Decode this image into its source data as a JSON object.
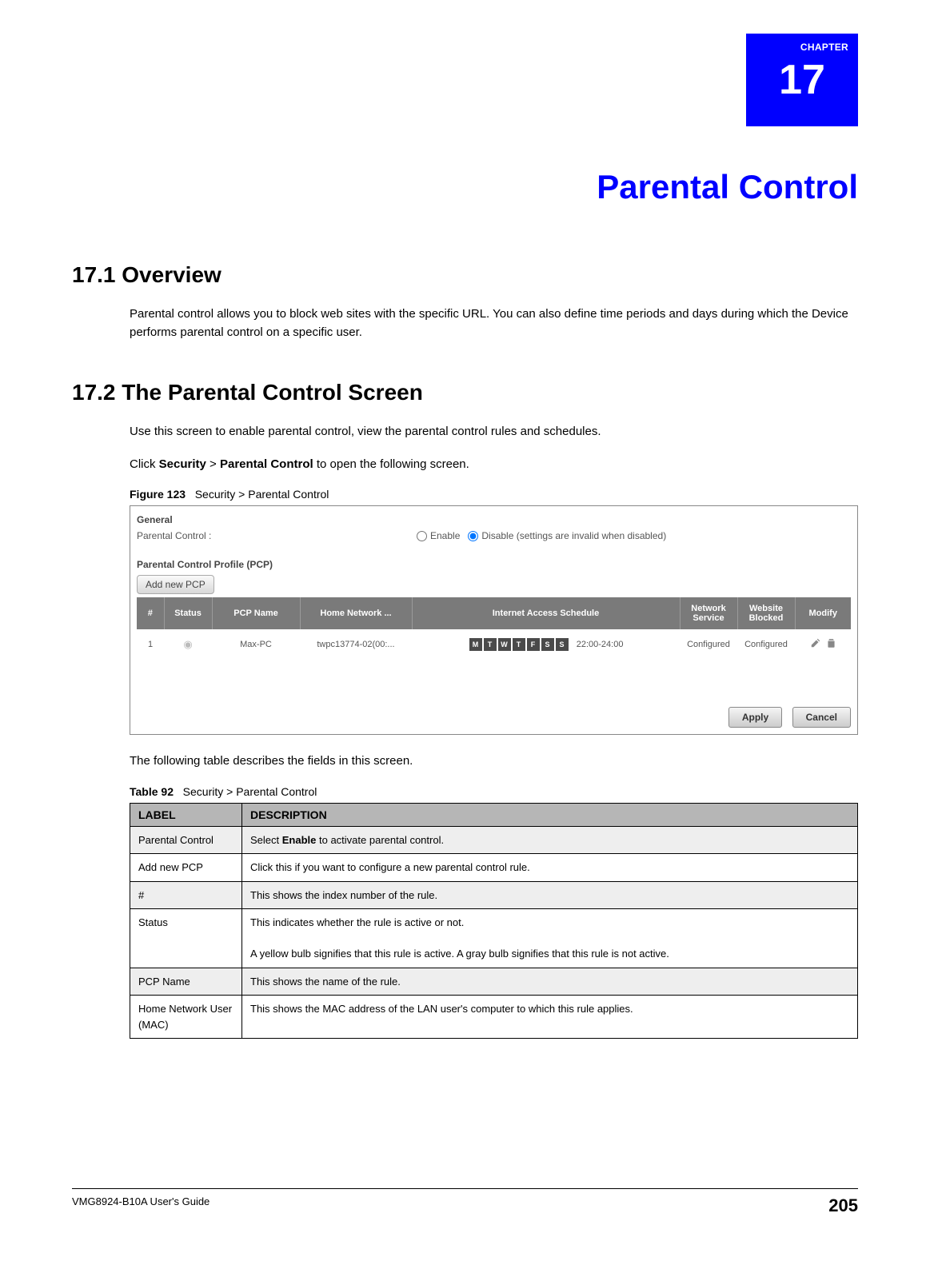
{
  "chapter": {
    "word": "CHAPTER",
    "number": "17",
    "title": "Parental Control"
  },
  "sec1": {
    "heading": "17.1  Overview",
    "p1": "Parental control allows you to block web sites with the specific URL. You can also define time periods and days during which the Device performs parental control on a specific user."
  },
  "sec2": {
    "heading": "17.2  The Parental Control Screen",
    "p1": "Use this screen to enable parental control, view the parental control rules and schedules.",
    "p2_pre": "Click ",
    "p2_b1": "Security",
    "p2_mid": " > ",
    "p2_b2": "Parental Control",
    "p2_post": " to open the following screen."
  },
  "figure": {
    "label": "Figure 123",
    "title": "Security > Parental Control",
    "general_label": "General",
    "pc_label": "Parental Control :",
    "enable": "Enable",
    "disable": "Disable",
    "disable_note": "(settings are invalid when disabled)",
    "pcp_heading": "Parental Control Profile (PCP)",
    "add_btn": "Add new PCP",
    "cols": {
      "idx": "#",
      "status": "Status",
      "pcp_name": "PCP Name",
      "home_net": "Home Network ...",
      "ias": "Internet Access Schedule",
      "net_svc": "Network Service",
      "web_blk": "Website Blocked",
      "modify": "Modify"
    },
    "row": {
      "idx": "1",
      "pcp_name": "Max-PC",
      "home_net": "twpc13774-02(00:...",
      "days": [
        "M",
        "T",
        "W",
        "T",
        "F",
        "S",
        "S"
      ],
      "time": "22:00-24:00",
      "net_svc": "Configured",
      "web_blk": "Configured"
    },
    "apply_btn": "Apply",
    "cancel_btn": "Cancel"
  },
  "after_fig_p": "The following table describes the fields in this screen.",
  "table_caption": {
    "label": "Table 92",
    "title": "Security > Parental Control"
  },
  "desc_table": {
    "header": {
      "label": "LABEL",
      "desc": "DESCRIPTION"
    },
    "rows": [
      {
        "label": "Parental Control",
        "desc_pre": "Select ",
        "desc_b": "Enable",
        "desc_post": " to activate parental control."
      },
      {
        "label": "Add new PCP",
        "desc": "Click this if you want to configure a new parental control rule."
      },
      {
        "label": "#",
        "desc": "This shows the index number of the rule."
      },
      {
        "label": "Status",
        "desc_line1": "This indicates whether the rule is active or not.",
        "desc_line2": "A yellow bulb signifies that this rule is active. A gray bulb signifies that this rule is not active."
      },
      {
        "label": "PCP Name",
        "desc": "This shows the name of the rule."
      },
      {
        "label": "Home Network User (MAC)",
        "desc": "This shows the MAC address of the LAN user's computer to which this rule applies."
      }
    ]
  },
  "footer": {
    "guide": "VMG8924-B10A User's Guide",
    "page": "205"
  }
}
